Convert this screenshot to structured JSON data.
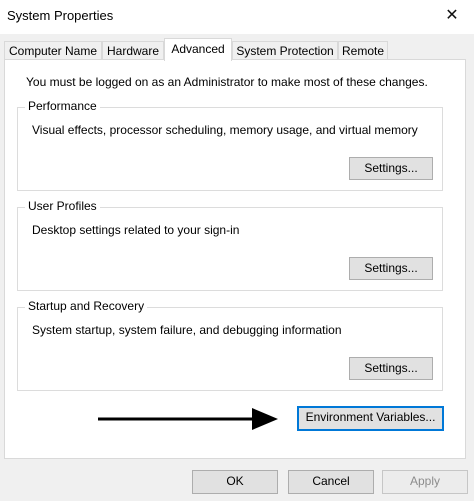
{
  "window": {
    "title": "System Properties",
    "close_glyph": "✕"
  },
  "tabs": [
    {
      "label": "Computer Name",
      "active": false
    },
    {
      "label": "Hardware",
      "active": false
    },
    {
      "label": "Advanced",
      "active": true
    },
    {
      "label": "System Protection",
      "active": false
    },
    {
      "label": "Remote",
      "active": false
    }
  ],
  "notice": "You must be logged on as an Administrator to make most of these changes.",
  "groups": {
    "performance": {
      "title": "Performance",
      "description": "Visual effects, processor scheduling, memory usage, and virtual memory",
      "button": "Settings..."
    },
    "user_profiles": {
      "title": "User Profiles",
      "description": "Desktop settings related to your sign-in",
      "button": "Settings..."
    },
    "startup_recovery": {
      "title": "Startup and Recovery",
      "description": "System startup, system failure, and debugging information",
      "button": "Settings..."
    }
  },
  "environment_button": "Environment Variables...",
  "footer": {
    "ok": "OK",
    "cancel": "Cancel",
    "apply": "Apply",
    "apply_enabled": false
  },
  "colors": {
    "focus": "#0078d7",
    "arrow": "#000000"
  }
}
